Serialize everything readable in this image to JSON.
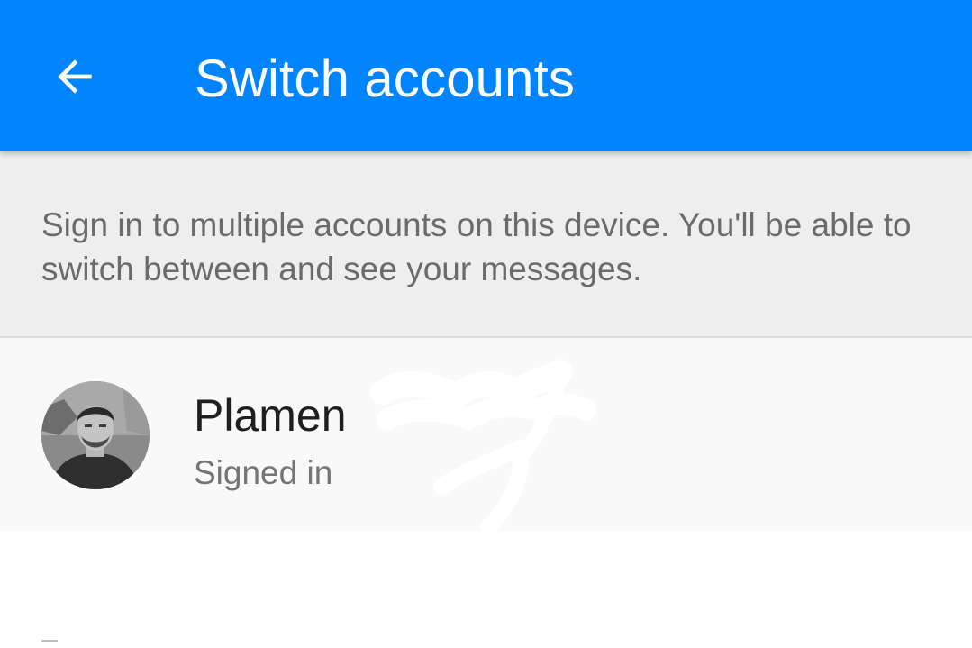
{
  "app_bar": {
    "title": "Switch accounts",
    "back_icon": "arrow-back-icon",
    "background_color": "#0084ff"
  },
  "info": {
    "text": "Sign in to multiple accounts on this device. You'll be able to switch between and see your messages."
  },
  "accounts": [
    {
      "name": "Plamen",
      "status": "Signed in"
    }
  ]
}
